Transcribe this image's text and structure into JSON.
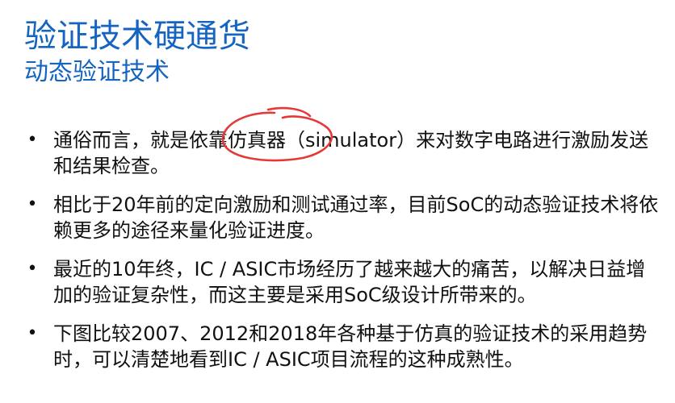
{
  "slide": {
    "title": "验证技术硬通货",
    "subtitle": "动态验证技术",
    "bullets": [
      "通俗而言，就是依靠仿真器（simulator）来对数字电路进行激励发送和结果检查。",
      "相比于20年前的定向激励和测试通过率，目前SoC的动态验证技术将依赖更多的途径来量化验证进度。",
      "最近的10年终，IC / ASIC市场经历了越来越大的痛苦，以解决日益增加的验证复杂性，而这主要是采用SoC级设计所带来的。",
      "下图比较2007、2012和2018年各种基于仿真的验证技术的采用趋势时，可以清楚地看到IC / ASIC项目流程的这种成熟性。"
    ]
  },
  "colors": {
    "title": "#1565c0",
    "body_text": "#111111",
    "annotation": "#e53935"
  }
}
